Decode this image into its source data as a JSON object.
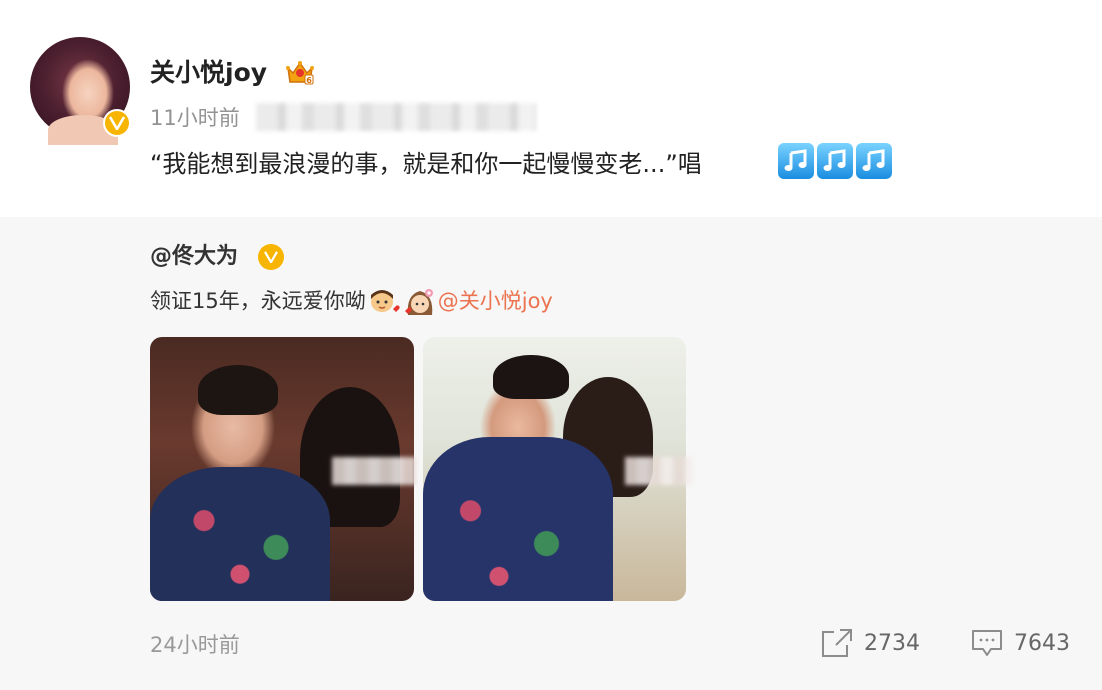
{
  "post": {
    "username": "关小悦joy",
    "time": "11小时前",
    "text": "“我能想到最浪漫的事，就是和你一起慢慢变老...”唱"
  },
  "repost": {
    "author": "@佟大为",
    "text": "领证15年，永远爱你呦",
    "mention": "@关小悦joy",
    "time": "24小时前",
    "repost_count": "2734",
    "comment_count": "7643"
  },
  "colors": {
    "verified": "#f7b500",
    "mention": "#eb7350",
    "repost_background": "#f7f7f7"
  },
  "icons": [
    "verified-icon",
    "crown-vip-icon",
    "music-note-icon",
    "emoji-boy-icon",
    "emoji-girl-icon",
    "share-icon",
    "comment-icon"
  ]
}
